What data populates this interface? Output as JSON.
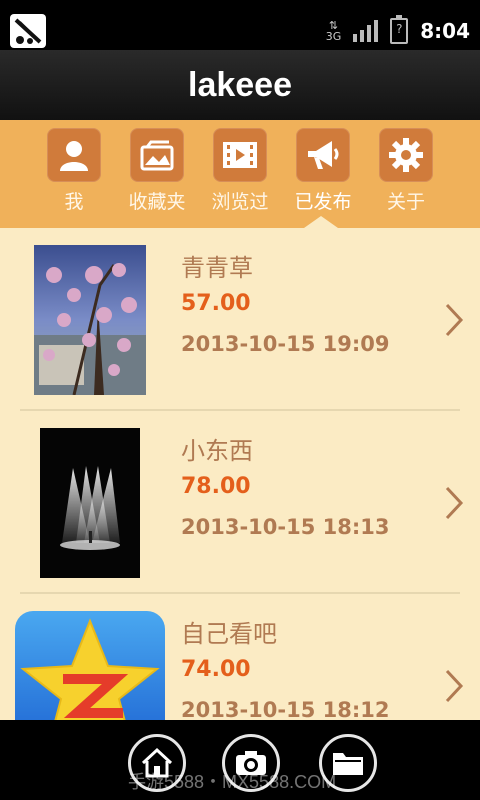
{
  "status_bar": {
    "time": "8:04",
    "network": "3G",
    "battery_text": "?"
  },
  "header": {
    "title": "lakeee"
  },
  "tabs": [
    {
      "label": "我",
      "icon": "user-icon"
    },
    {
      "label": "收藏夹",
      "icon": "favorites-icon"
    },
    {
      "label": "浏览过",
      "icon": "video-icon"
    },
    {
      "label": "已发布",
      "icon": "megaphone-icon",
      "active": true
    },
    {
      "label": "关于",
      "icon": "gear-icon"
    }
  ],
  "items": [
    {
      "title": "青青草",
      "price": "57.00",
      "date": "2013-10-15 19:09"
    },
    {
      "title": "小东西",
      "price": "78.00",
      "date": "2013-10-15 18:13"
    },
    {
      "title": "自己看吧",
      "price": "74.00",
      "date": "2013-10-15 18:12"
    }
  ],
  "bottom_nav": {
    "watermark": "手游5588・MX5588.COM"
  },
  "colors": {
    "tab_bar": "#f0b15a",
    "list_bg": "#fbebc4",
    "price": "#e45f1b"
  }
}
